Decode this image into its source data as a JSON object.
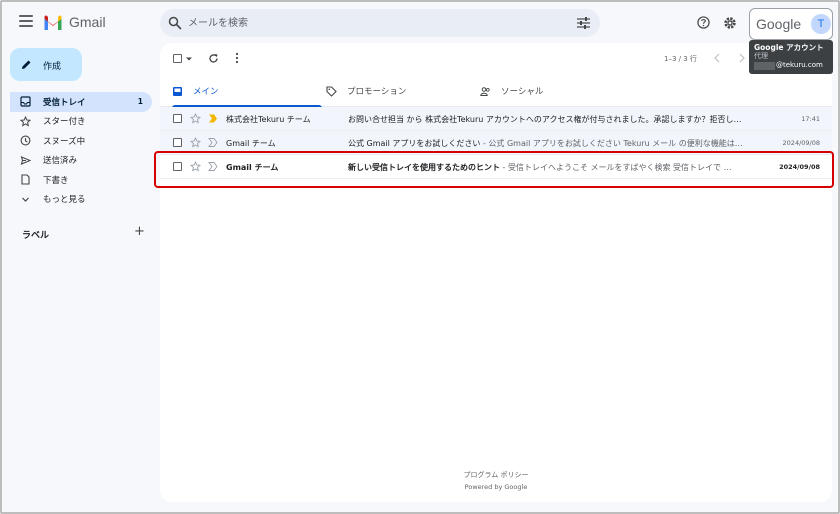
{
  "app": {
    "logo_text": "Gmail"
  },
  "search": {
    "placeholder": "メールを検索",
    "value": ""
  },
  "account": {
    "brand": "Google",
    "avatar_letter": "T",
    "tooltip_title": "Google アカウント",
    "tooltip_sub": "代理",
    "tooltip_email": "@tekuru.com"
  },
  "compose": {
    "label": "作成"
  },
  "sidebar": {
    "items": [
      {
        "label": "受信トレイ",
        "count": "1",
        "icon": "inbox-icon",
        "active": true
      },
      {
        "label": "スター付き",
        "count": "",
        "icon": "star-icon",
        "active": false
      },
      {
        "label": "スヌーズ中",
        "count": "",
        "icon": "clock-icon",
        "active": false
      },
      {
        "label": "送信済み",
        "count": "",
        "icon": "send-icon",
        "active": false
      },
      {
        "label": "下書き",
        "count": "",
        "icon": "draft-icon",
        "active": false
      },
      {
        "label": "もっと見る",
        "count": "",
        "icon": "chevron-down-icon",
        "active": false
      }
    ],
    "labels_heading": "ラベル",
    "labels_add": "+"
  },
  "toolbar": {
    "pager": "1–3 / 3 行"
  },
  "tabs": [
    {
      "label": "メイン",
      "active": true
    },
    {
      "label": "プロモーション",
      "active": false
    },
    {
      "label": "ソーシャル",
      "active": false
    }
  ],
  "emails": [
    {
      "sender": "株式会社Tekuru チーム",
      "subject": "お問い合せ担当 から 株式会社Tekuru アカウントへのアクセス権が付与されました。承認しますか？拒否し…",
      "snippet": "",
      "date": "17:41",
      "unread": false,
      "important": true
    },
    {
      "sender": "Gmail チーム",
      "subject": "公式 Gmail アプリをお試しください",
      "snippet": " - 公式 Gmail アプリをお試しください Tekuru メール の便利な機能は…",
      "date": "2024/09/08",
      "unread": false,
      "important": false
    },
    {
      "sender": "Gmail チーム",
      "subject": "新しい受信トレイを使用するためのヒント",
      "snippet": " - 受信トレイへようこそ メールをすばやく検索 受信トレイで …",
      "date": "2024/09/08",
      "unread": true,
      "important": false
    }
  ],
  "footer": {
    "policy": "プログラム ポリシー",
    "powered": "Powered by Google"
  },
  "colors": {
    "accent": "#0b57d0",
    "compose_bg": "#c2e7ff",
    "active_nav": "#d3e3fd",
    "highlight_border": "#d50000",
    "important_marker": "#f2b600"
  }
}
